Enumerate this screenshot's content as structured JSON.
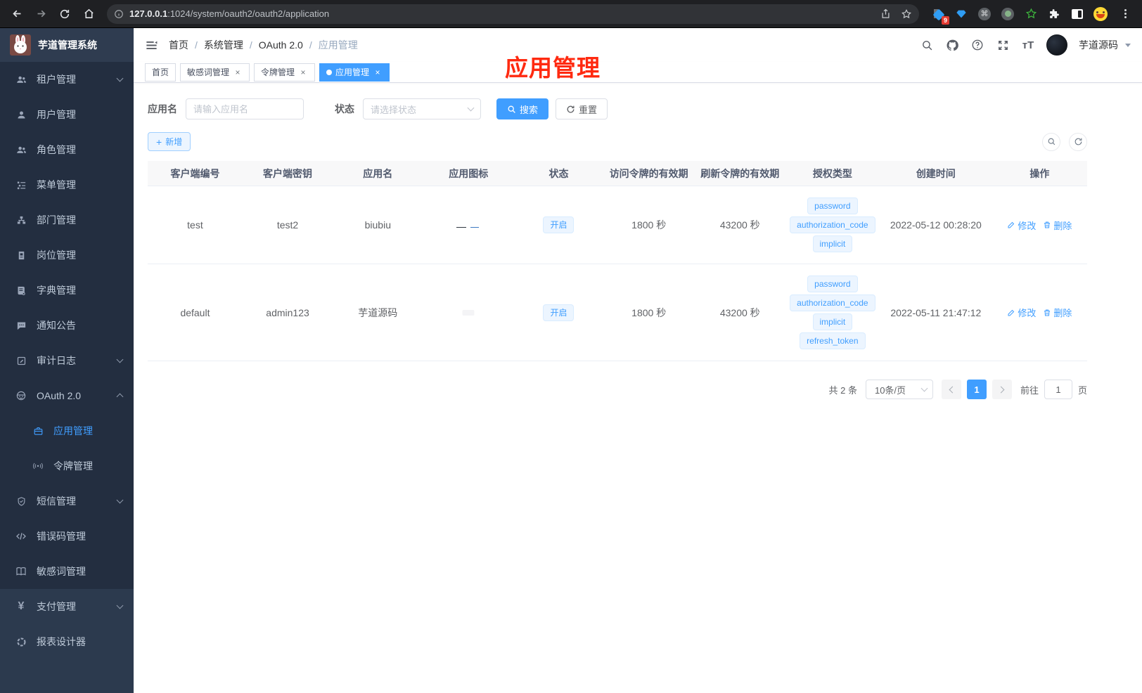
{
  "chrome": {
    "url_host": "127.0.0.1",
    "url_rest": ":1024/system/oauth2/oauth2/application",
    "ext_badge": "9"
  },
  "sidebar": {
    "title": "芋道管理系统",
    "items": [
      {
        "label": "租户管理"
      },
      {
        "label": "用户管理"
      },
      {
        "label": "角色管理"
      },
      {
        "label": "菜单管理"
      },
      {
        "label": "部门管理"
      },
      {
        "label": "岗位管理"
      },
      {
        "label": "字典管理"
      },
      {
        "label": "通知公告"
      },
      {
        "label": "审计日志"
      },
      {
        "label": "OAuth 2.0"
      },
      {
        "label": "应用管理"
      },
      {
        "label": "令牌管理"
      },
      {
        "label": "短信管理"
      },
      {
        "label": "错误码管理"
      },
      {
        "label": "敏感词管理"
      },
      {
        "label": "支付管理"
      },
      {
        "label": "报表设计器"
      }
    ]
  },
  "navbar": {
    "breadcrumb": [
      "首页",
      "系统管理",
      "OAuth 2.0",
      "应用管理"
    ],
    "user": "芋道源码"
  },
  "annotation": {
    "text": "应用管理",
    "color": "#ff2a10"
  },
  "tabs": [
    {
      "label": "首页"
    },
    {
      "label": "敏感词管理"
    },
    {
      "label": "令牌管理"
    },
    {
      "label": "应用管理"
    }
  ],
  "filters": {
    "name_label": "应用名",
    "name_placeholder": "请输入应用名",
    "status_label": "状态",
    "status_placeholder": "请选择状态",
    "search_label": "搜索",
    "reset_label": "重置"
  },
  "toolbar": {
    "add_label": "新增"
  },
  "table": {
    "columns": [
      "客户端编号",
      "客户端密钥",
      "应用名",
      "应用图标",
      "状态",
      "访问令牌的有效期",
      "刷新令牌的有效期",
      "授权类型",
      "创建时间",
      "操作"
    ],
    "edit_label": "修改",
    "delete_label": "删除",
    "rows": [
      {
        "client_id": "test",
        "client_secret": "test2",
        "app_name": "biubiu",
        "status": "开启",
        "access_token_ttl": "1800 秒",
        "refresh_token_ttl": "43200 秒",
        "grant_types": [
          "password",
          "authorization_code",
          "implicit"
        ],
        "created_at": "2022-05-12 00:28:20"
      },
      {
        "client_id": "default",
        "client_secret": "admin123",
        "app_name": "芋道源码",
        "status": "开启",
        "access_token_ttl": "1800 秒",
        "refresh_token_ttl": "43200 秒",
        "grant_types": [
          "password",
          "authorization_code",
          "implicit",
          "refresh_token"
        ],
        "created_at": "2022-05-11 21:47:12"
      }
    ]
  },
  "pagination": {
    "total": "共 2 条",
    "page_size": "10条/页",
    "page": "1",
    "goto_prefix": "前往",
    "goto_value": "1",
    "goto_suffix": "页"
  },
  "colors": {
    "accent": "#409eff"
  }
}
